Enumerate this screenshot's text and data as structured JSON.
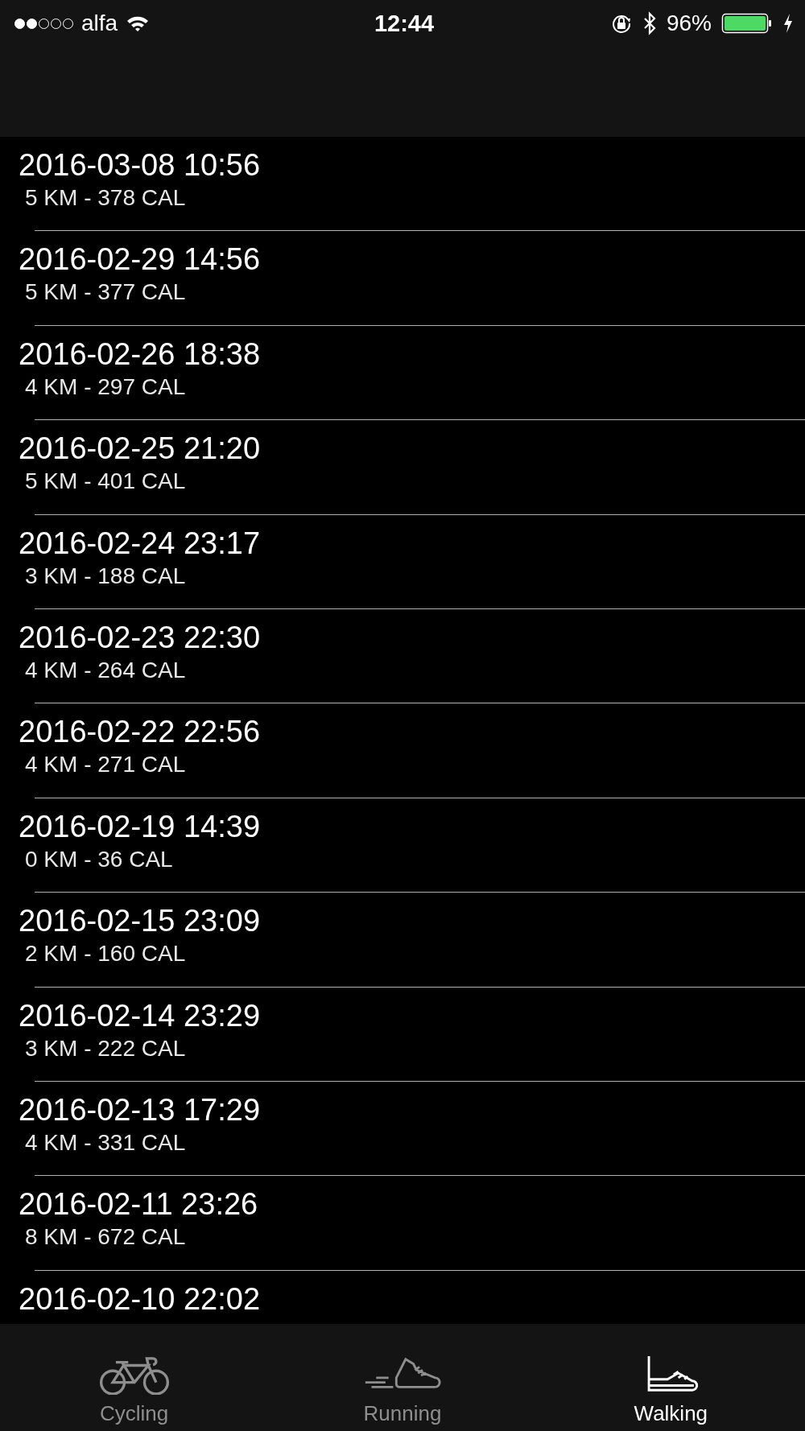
{
  "status_bar": {
    "carrier": "alfa",
    "time": "12:44",
    "battery": "96%",
    "signal": [
      {
        "on": true
      },
      {
        "on": true
      },
      {
        "on": false
      },
      {
        "on": false
      },
      {
        "on": false
      }
    ]
  },
  "workouts": [
    {
      "date": "2016-03-08 10:56",
      "summary": "5 KM - 378 CAL"
    },
    {
      "date": "2016-02-29 14:56",
      "summary": "5 KM - 377 CAL"
    },
    {
      "date": "2016-02-26 18:38",
      "summary": "4 KM - 297 CAL"
    },
    {
      "date": "2016-02-25 21:20",
      "summary": "5 KM - 401 CAL"
    },
    {
      "date": "2016-02-24 23:17",
      "summary": "3 KM - 188 CAL"
    },
    {
      "date": "2016-02-23 22:30",
      "summary": "4 KM - 264 CAL"
    },
    {
      "date": "2016-02-22 22:56",
      "summary": "4 KM - 271 CAL"
    },
    {
      "date": "2016-02-19 14:39",
      "summary": "0 KM - 36 CAL"
    },
    {
      "date": "2016-02-15 23:09",
      "summary": "2 KM - 160 CAL"
    },
    {
      "date": "2016-02-14 23:29",
      "summary": "3 KM - 222 CAL"
    },
    {
      "date": "2016-02-13 17:29",
      "summary": "4 KM - 331 CAL"
    },
    {
      "date": "2016-02-11 23:26",
      "summary": "8 KM - 672 CAL"
    },
    {
      "date": "2016-02-10 22:02"
    }
  ],
  "tabs": [
    {
      "label": "Cycling",
      "kind": "bicycle",
      "selected": false
    },
    {
      "label": "Running",
      "kind": "running",
      "selected": false
    },
    {
      "label": "Walking",
      "kind": "walking",
      "selected": true
    }
  ]
}
